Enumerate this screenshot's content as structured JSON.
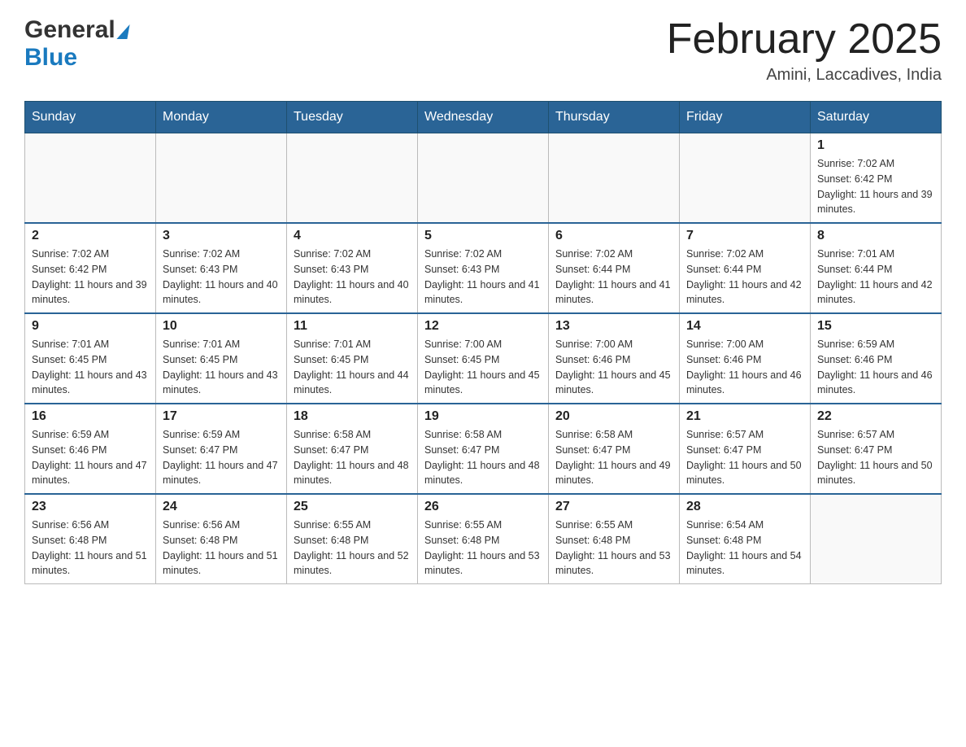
{
  "header": {
    "logo_general": "General",
    "logo_blue": "Blue",
    "month_title": "February 2025",
    "location": "Amini, Laccadives, India"
  },
  "days_of_week": [
    "Sunday",
    "Monday",
    "Tuesday",
    "Wednesday",
    "Thursday",
    "Friday",
    "Saturday"
  ],
  "weeks": [
    [
      {
        "day": "",
        "sunrise": "",
        "sunset": "",
        "daylight": ""
      },
      {
        "day": "",
        "sunrise": "",
        "sunset": "",
        "daylight": ""
      },
      {
        "day": "",
        "sunrise": "",
        "sunset": "",
        "daylight": ""
      },
      {
        "day": "",
        "sunrise": "",
        "sunset": "",
        "daylight": ""
      },
      {
        "day": "",
        "sunrise": "",
        "sunset": "",
        "daylight": ""
      },
      {
        "day": "",
        "sunrise": "",
        "sunset": "",
        "daylight": ""
      },
      {
        "day": "1",
        "sunrise": "Sunrise: 7:02 AM",
        "sunset": "Sunset: 6:42 PM",
        "daylight": "Daylight: 11 hours and 39 minutes."
      }
    ],
    [
      {
        "day": "2",
        "sunrise": "Sunrise: 7:02 AM",
        "sunset": "Sunset: 6:42 PM",
        "daylight": "Daylight: 11 hours and 39 minutes."
      },
      {
        "day": "3",
        "sunrise": "Sunrise: 7:02 AM",
        "sunset": "Sunset: 6:43 PM",
        "daylight": "Daylight: 11 hours and 40 minutes."
      },
      {
        "day": "4",
        "sunrise": "Sunrise: 7:02 AM",
        "sunset": "Sunset: 6:43 PM",
        "daylight": "Daylight: 11 hours and 40 minutes."
      },
      {
        "day": "5",
        "sunrise": "Sunrise: 7:02 AM",
        "sunset": "Sunset: 6:43 PM",
        "daylight": "Daylight: 11 hours and 41 minutes."
      },
      {
        "day": "6",
        "sunrise": "Sunrise: 7:02 AM",
        "sunset": "Sunset: 6:44 PM",
        "daylight": "Daylight: 11 hours and 41 minutes."
      },
      {
        "day": "7",
        "sunrise": "Sunrise: 7:02 AM",
        "sunset": "Sunset: 6:44 PM",
        "daylight": "Daylight: 11 hours and 42 minutes."
      },
      {
        "day": "8",
        "sunrise": "Sunrise: 7:01 AM",
        "sunset": "Sunset: 6:44 PM",
        "daylight": "Daylight: 11 hours and 42 minutes."
      }
    ],
    [
      {
        "day": "9",
        "sunrise": "Sunrise: 7:01 AM",
        "sunset": "Sunset: 6:45 PM",
        "daylight": "Daylight: 11 hours and 43 minutes."
      },
      {
        "day": "10",
        "sunrise": "Sunrise: 7:01 AM",
        "sunset": "Sunset: 6:45 PM",
        "daylight": "Daylight: 11 hours and 43 minutes."
      },
      {
        "day": "11",
        "sunrise": "Sunrise: 7:01 AM",
        "sunset": "Sunset: 6:45 PM",
        "daylight": "Daylight: 11 hours and 44 minutes."
      },
      {
        "day": "12",
        "sunrise": "Sunrise: 7:00 AM",
        "sunset": "Sunset: 6:45 PM",
        "daylight": "Daylight: 11 hours and 45 minutes."
      },
      {
        "day": "13",
        "sunrise": "Sunrise: 7:00 AM",
        "sunset": "Sunset: 6:46 PM",
        "daylight": "Daylight: 11 hours and 45 minutes."
      },
      {
        "day": "14",
        "sunrise": "Sunrise: 7:00 AM",
        "sunset": "Sunset: 6:46 PM",
        "daylight": "Daylight: 11 hours and 46 minutes."
      },
      {
        "day": "15",
        "sunrise": "Sunrise: 6:59 AM",
        "sunset": "Sunset: 6:46 PM",
        "daylight": "Daylight: 11 hours and 46 minutes."
      }
    ],
    [
      {
        "day": "16",
        "sunrise": "Sunrise: 6:59 AM",
        "sunset": "Sunset: 6:46 PM",
        "daylight": "Daylight: 11 hours and 47 minutes."
      },
      {
        "day": "17",
        "sunrise": "Sunrise: 6:59 AM",
        "sunset": "Sunset: 6:47 PM",
        "daylight": "Daylight: 11 hours and 47 minutes."
      },
      {
        "day": "18",
        "sunrise": "Sunrise: 6:58 AM",
        "sunset": "Sunset: 6:47 PM",
        "daylight": "Daylight: 11 hours and 48 minutes."
      },
      {
        "day": "19",
        "sunrise": "Sunrise: 6:58 AM",
        "sunset": "Sunset: 6:47 PM",
        "daylight": "Daylight: 11 hours and 48 minutes."
      },
      {
        "day": "20",
        "sunrise": "Sunrise: 6:58 AM",
        "sunset": "Sunset: 6:47 PM",
        "daylight": "Daylight: 11 hours and 49 minutes."
      },
      {
        "day": "21",
        "sunrise": "Sunrise: 6:57 AM",
        "sunset": "Sunset: 6:47 PM",
        "daylight": "Daylight: 11 hours and 50 minutes."
      },
      {
        "day": "22",
        "sunrise": "Sunrise: 6:57 AM",
        "sunset": "Sunset: 6:47 PM",
        "daylight": "Daylight: 11 hours and 50 minutes."
      }
    ],
    [
      {
        "day": "23",
        "sunrise": "Sunrise: 6:56 AM",
        "sunset": "Sunset: 6:48 PM",
        "daylight": "Daylight: 11 hours and 51 minutes."
      },
      {
        "day": "24",
        "sunrise": "Sunrise: 6:56 AM",
        "sunset": "Sunset: 6:48 PM",
        "daylight": "Daylight: 11 hours and 51 minutes."
      },
      {
        "day": "25",
        "sunrise": "Sunrise: 6:55 AM",
        "sunset": "Sunset: 6:48 PM",
        "daylight": "Daylight: 11 hours and 52 minutes."
      },
      {
        "day": "26",
        "sunrise": "Sunrise: 6:55 AM",
        "sunset": "Sunset: 6:48 PM",
        "daylight": "Daylight: 11 hours and 53 minutes."
      },
      {
        "day": "27",
        "sunrise": "Sunrise: 6:55 AM",
        "sunset": "Sunset: 6:48 PM",
        "daylight": "Daylight: 11 hours and 53 minutes."
      },
      {
        "day": "28",
        "sunrise": "Sunrise: 6:54 AM",
        "sunset": "Sunset: 6:48 PM",
        "daylight": "Daylight: 11 hours and 54 minutes."
      },
      {
        "day": "",
        "sunrise": "",
        "sunset": "",
        "daylight": ""
      }
    ]
  ]
}
